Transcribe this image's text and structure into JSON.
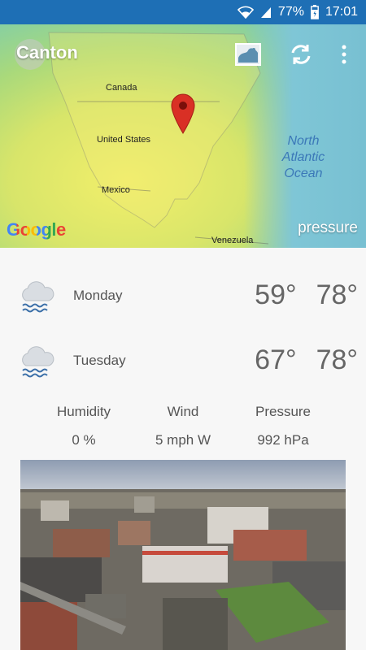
{
  "status_bar": {
    "battery": "77%",
    "time": "17:01",
    "icons": [
      "wifi-icon",
      "signal-icon",
      "battery-icon"
    ]
  },
  "map": {
    "city": "Canton",
    "labels": {
      "canada": "Canada",
      "united_states": "United States",
      "mexico": "Mexico",
      "venezuela": "Venezuela",
      "ocean_line1": "North",
      "ocean_line2": "Atlantic",
      "ocean_line3": "Ocean"
    },
    "google_logo": "Google",
    "layer": "pressure",
    "icons": [
      "map-layers-icon",
      "refresh-icon",
      "more-vert-icon",
      "map-pin-icon"
    ]
  },
  "forecast": [
    {
      "day": "Monday",
      "low": "59°",
      "high": "78°",
      "icon": "rain-cloud-icon"
    },
    {
      "day": "Tuesday",
      "low": "67°",
      "high": "78°",
      "icon": "rain-cloud-icon"
    }
  ],
  "details": {
    "humidity_label": "Humidity",
    "wind_label": "Wind",
    "pressure_label": "Pressure",
    "humidity_value": "0 %",
    "wind_value": "5 mph W",
    "pressure_value": "992 hPa"
  },
  "colors": {
    "status_bar": "#1e6fb5",
    "pin": "#d93025",
    "rain": "#3b6fa8"
  }
}
